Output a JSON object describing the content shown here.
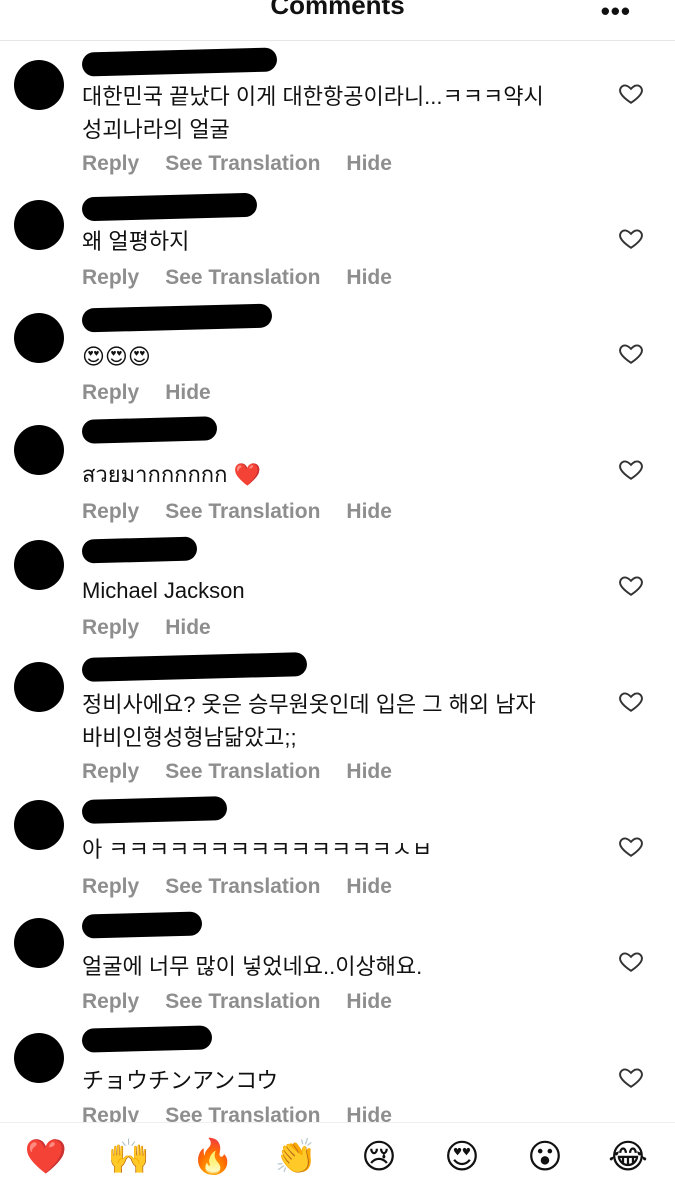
{
  "header": {
    "title": "Comments",
    "more_glyph": "•••"
  },
  "comments": [
    {
      "text": "대한민국 끝났다 이게 대한항공이라니...ㅋㅋㅋ약시\n성괴나라의 얼굴",
      "actions": [
        "Reply",
        "See Translation",
        "Hide"
      ]
    },
    {
      "text": "왜 얼평하지",
      "actions": [
        "Reply",
        "See Translation",
        "Hide"
      ]
    },
    {
      "text": "😍😍😍",
      "actions": [
        "Reply",
        "Hide"
      ]
    },
    {
      "text": "สวยมากกกกกก ❤️",
      "actions": [
        "Reply",
        "See Translation",
        "Hide"
      ]
    },
    {
      "text": "Michael Jackson",
      "actions": [
        "Reply",
        "Hide"
      ]
    },
    {
      "text": "정비사에요? 옷은 승무원옷인데 입은 그 해외 남자\n바비인형성형남닮았고;;",
      "actions": [
        "Reply",
        "See Translation",
        "Hide"
      ]
    },
    {
      "text": "아 ㅋㅋㅋㅋㅋㅋㅋㅋㅋㅋㅋㅋㅋㅋㅅㅂ",
      "actions": [
        "Reply",
        "See Translation",
        "Hide"
      ]
    },
    {
      "text": "얼굴에 너무 많이 넣었네요..이상해요.",
      "actions": [
        "Reply",
        "See Translation",
        "Hide"
      ]
    },
    {
      "text": "チョウチンアンコウ",
      "actions": [
        "Reply",
        "See Translation",
        "Hide"
      ]
    }
  ],
  "reactions": [
    "❤️",
    "🙌",
    "🔥",
    "👏",
    "😢",
    "😍",
    "😮",
    "😂"
  ],
  "colors": {
    "action_gray": "#8e8e8e",
    "redaction": "#000000",
    "divider": "#e6e6e6"
  }
}
